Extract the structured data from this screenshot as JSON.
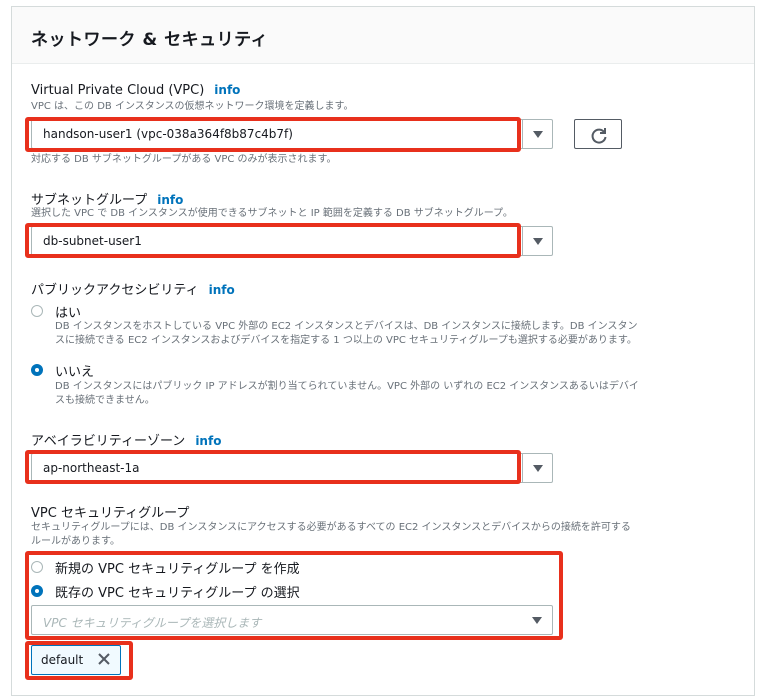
{
  "title": "ネットワーク & セキュリティ",
  "vpc": {
    "label": "Virtual Private Cloud (VPC)",
    "info": "info",
    "description": "VPC は、この DB インスタンスの仮想ネットワーク環境を定義します。",
    "selected": "handson-user1 (vpc-038a364f8b87c4b7f)",
    "hint": "対応する DB サブネットグループがある VPC のみが表示されます。"
  },
  "subnet": {
    "label": "サブネットグループ",
    "info": "info",
    "description": "選択した VPC で DB インスタンスが使用できるサブネットと IP 範囲を定義する DB サブネットグループ。",
    "selected": "db-subnet-user1"
  },
  "public_access": {
    "label": "パブリックアクセシビリティ",
    "info": "info",
    "options": [
      {
        "label": "はい",
        "description_line1": "DB インスタンスをホストしている VPC 外部の EC2 インスタンスとデバイスは、DB インスタンスに接続します。DB インスタン",
        "description_line2": "スに接続できる EC2 インスタンスおよびデバイスを指定する 1 つ以上の VPC セキュリティグループも選択する必要があります。",
        "selected": false
      },
      {
        "label": "いいえ",
        "description_line1": "DB インスタンスにはパブリック IP アドレスが割り当てられていません。VPC 外部の いずれの EC2 インスタンスあるいはデバイ",
        "description_line2": "スも接続できません。",
        "selected": true
      }
    ]
  },
  "az": {
    "label": "アベイラビリティーゾーン",
    "info": "info",
    "selected": "ap-northeast-1a"
  },
  "security_group": {
    "label": "VPC セキュリティグループ",
    "description_line1": "セキュリティグループには、DB インスタンスにアクセスする必要があるすべての EC2 インスタンスとデバイスからの接続を許可する",
    "description_line2": "ルールがあります。",
    "options": [
      {
        "label": "新規の VPC セキュリティグループ を作成",
        "selected": false
      },
      {
        "label": "既存の VPC セキュリティグループ の選択",
        "selected": true
      }
    ],
    "placeholder": "VPC セキュリティグループを選択します",
    "tokens": [
      "default"
    ]
  },
  "colors": {
    "accent": "#0073bb",
    "highlight": "#e8301c"
  },
  "icons": {
    "refresh": "refresh-icon",
    "caret": "caret-down-icon",
    "remove": "close-icon"
  }
}
